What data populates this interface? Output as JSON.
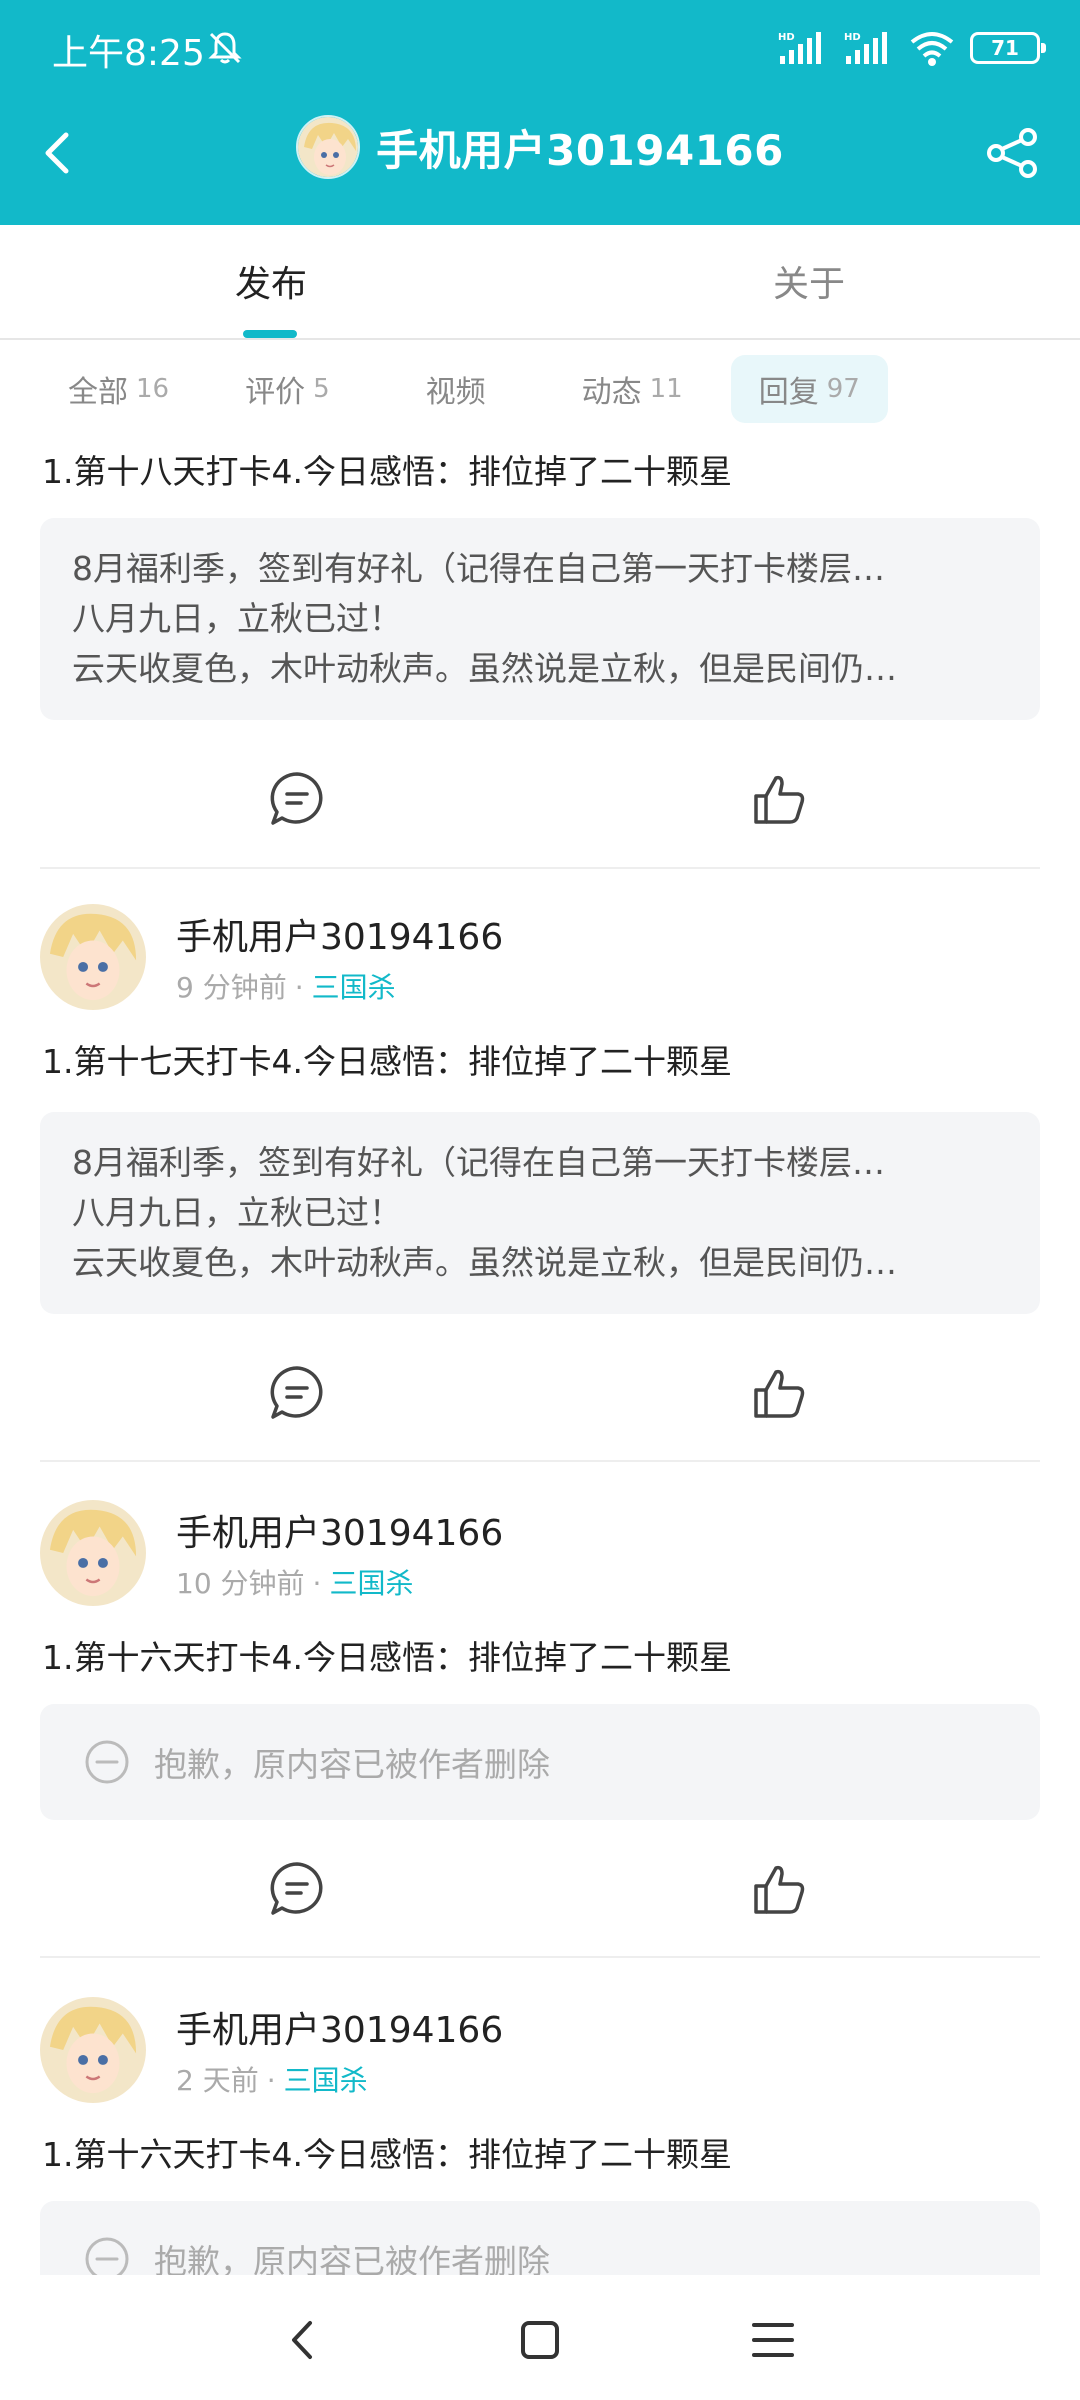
{
  "status_bar": {
    "time": "上午8:25",
    "battery": "71"
  },
  "header": {
    "title": "手机用户30194166"
  },
  "tabs": [
    {
      "label": "发布"
    },
    {
      "label": "关于"
    }
  ],
  "filters": [
    {
      "label": "全部",
      "count": "16"
    },
    {
      "label": "评价",
      "count": "5"
    },
    {
      "label": "视频",
      "count": ""
    },
    {
      "label": "动态",
      "count": "11"
    },
    {
      "label": "回复",
      "count": "97"
    }
  ],
  "posts": [
    {
      "title": "1.第十八天打卡4.今日感悟：排位掉了二十颗星",
      "quote": [
        "8月福利季，签到有好礼（记得在自己第一天打卡楼层…",
        "八月九日，立秋已过！",
        "云天收夏色，木叶动秋声。虽然说是立秋，但是民间仍…"
      ]
    },
    {
      "author": "手机用户30194166",
      "time": "9 分钟前",
      "dot": "·",
      "game": "三国杀",
      "title": "1.第十七天打卡4.今日感悟：排位掉了二十颗星",
      "quote": [
        "8月福利季，签到有好礼（记得在自己第一天打卡楼层…",
        "八月九日，立秋已过！",
        "云天收夏色，木叶动秋声。虽然说是立秋，但是民间仍…"
      ]
    },
    {
      "author": "手机用户30194166",
      "time": "10 分钟前",
      "dot": "·",
      "game": "三国杀",
      "title": "1.第十六天打卡4.今日感悟：排位掉了二十颗星",
      "deleted": "抱歉，原内容已被作者删除"
    },
    {
      "author": "手机用户30194166",
      "time": "2 天前",
      "dot": "·",
      "game": "三国杀",
      "title": "1.第十六天打卡4.今日感悟：排位掉了二十颗星",
      "deleted": "抱歉，原内容已被作者删除"
    }
  ],
  "colors": {
    "accent": "#12b9c9",
    "card_bg": "#f4f5f7"
  }
}
